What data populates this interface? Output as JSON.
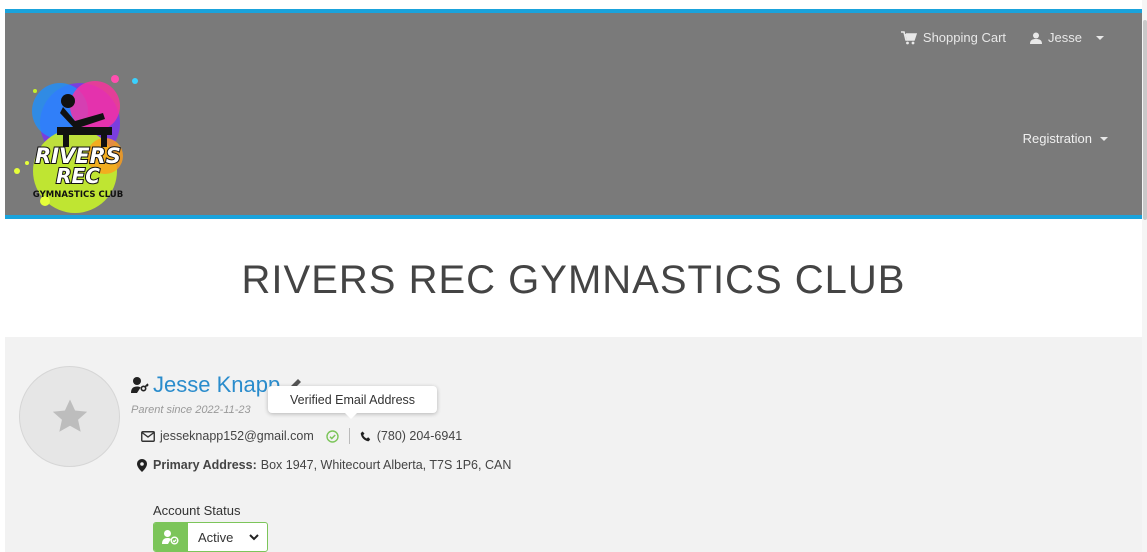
{
  "header": {
    "cart_label": "Shopping Cart",
    "user_label": "Jesse",
    "registration_label": "Registration",
    "logo": {
      "line1": "RIVERS",
      "line2": "REC",
      "line3": "GYMNASTICS CLUB"
    }
  },
  "site_title": "RIVERS REC GYMNASTICS CLUB",
  "profile": {
    "name": "Jesse Knapp",
    "since": "Parent since 2022-11-23",
    "email": "jesseknapp152@gmail.com",
    "phone": "(780) 204-6941",
    "address_label": "Primary Address:",
    "address": "Box 1947, Whitecourt Alberta, T7S 1P6, CAN",
    "tooltip": "Verified Email Address",
    "account_status_label": "Account Status",
    "account_status_value": "Active"
  },
  "colors": {
    "accent": "#1aa3dc",
    "header_bg": "#7a7a7a",
    "link": "#2a8ccc",
    "success": "#7cc55a"
  }
}
